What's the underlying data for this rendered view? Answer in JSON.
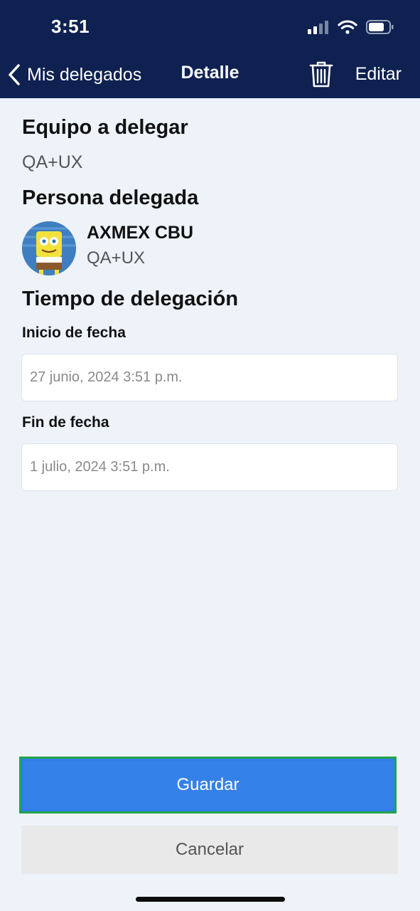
{
  "status_bar": {
    "time": "3:51"
  },
  "nav": {
    "back_label": "Mis delegados",
    "title": "Detalle",
    "edit_label": "Editar"
  },
  "team": {
    "heading": "Equipo a delegar",
    "value": "QA+UX"
  },
  "delegate": {
    "heading": "Persona delegada",
    "name": "AXMEX CBU",
    "team": "QA+UX"
  },
  "period": {
    "heading": "Tiempo de delegación",
    "start_label": "Inicio de fecha",
    "start_value": "27 junio, 2024 3:51 p.m.",
    "end_label": "Fin de fecha",
    "end_value": "1 julio, 2024 3:51 p.m."
  },
  "actions": {
    "save_label": "Guardar",
    "cancel_label": "Cancelar"
  },
  "colors": {
    "header_bg": "#0e2151",
    "primary": "#3481ea",
    "focus_outline": "#22a34c",
    "page_bg": "#eef3fa"
  }
}
